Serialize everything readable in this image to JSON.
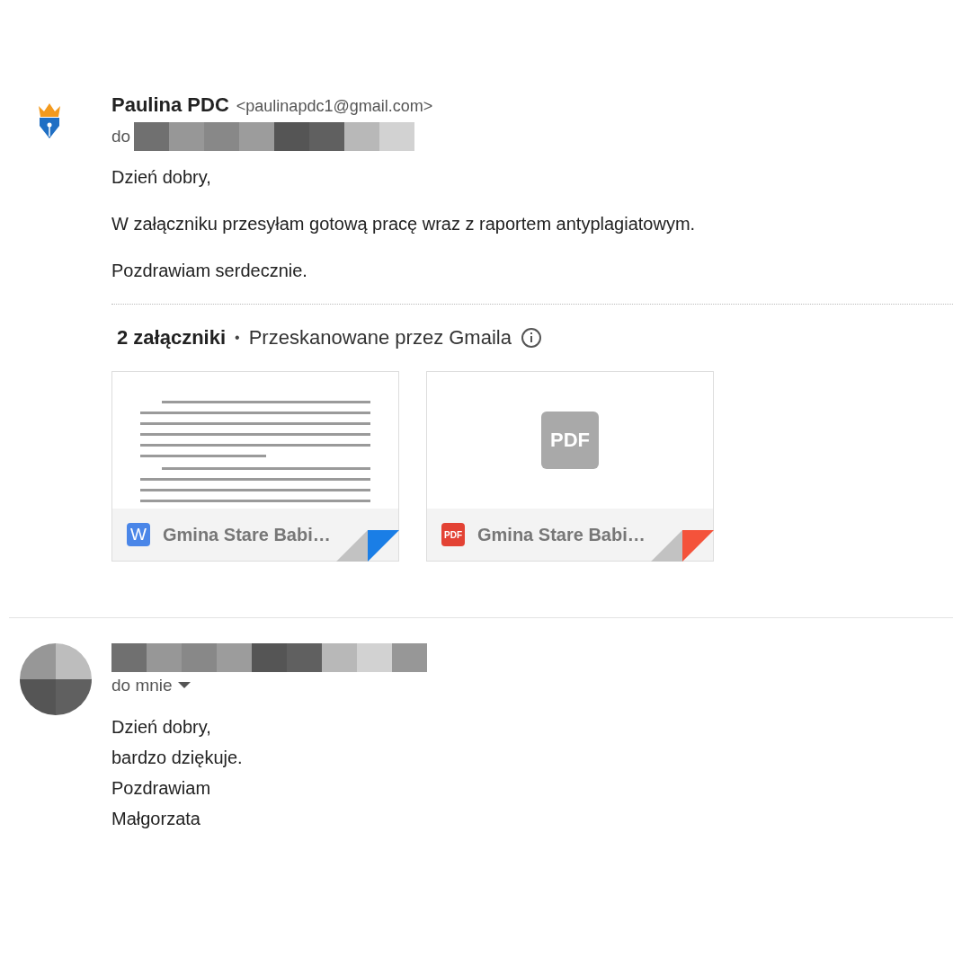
{
  "message": {
    "sender_name": "Paulina PDC",
    "sender_email": "<paulinapdc1@gmail.com>",
    "recipient_label": "do",
    "body": [
      "Dzień dobry,",
      "W załączniku przesyłam gotową pracę wraz z raportem antyplagiatowym.",
      "Pozdrawiam serdecznie."
    ],
    "attachments": {
      "count_label": "2 załączniki",
      "separator": "•",
      "scan_note": "Przeskanowane przez Gmaila",
      "items": [
        {
          "kind": "word",
          "type_label": "W",
          "name": "Gmina Stare Babi…",
          "color": "#1a7ee6"
        },
        {
          "kind": "pdf",
          "type_label": "PDF",
          "name": "Gmina Stare Babi…",
          "color": "#f4533b",
          "preview_label": "PDF"
        }
      ]
    }
  },
  "reply": {
    "recipient_label": "do mnie",
    "body": [
      "Dzień dobry,",
      "bardzo dziękuje.",
      "Pozdrawiam",
      "Małgorzata"
    ]
  }
}
